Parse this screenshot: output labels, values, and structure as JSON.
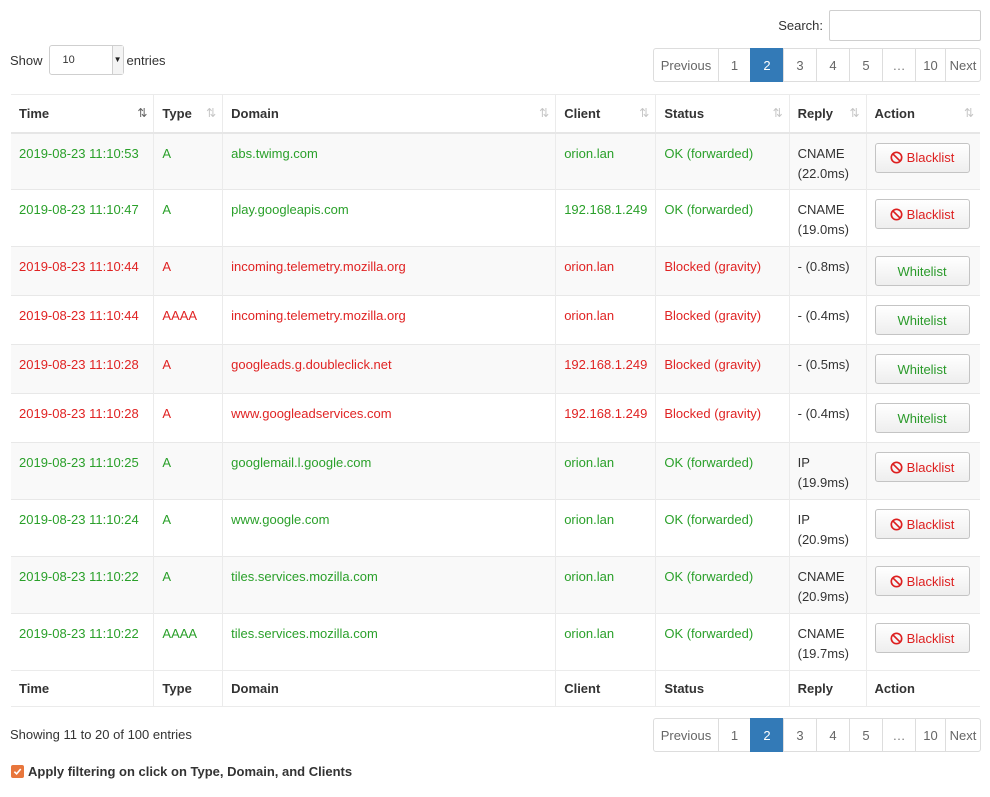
{
  "search": {
    "label": "Search:",
    "value": ""
  },
  "length": {
    "show": "Show",
    "value": "10",
    "entries": "entries"
  },
  "pagination": {
    "pages": [
      {
        "label": "Previous",
        "state": "normal",
        "w": 66
      },
      {
        "label": "1",
        "state": "normal",
        "w": 33
      },
      {
        "label": "2",
        "state": "active",
        "w": 34
      },
      {
        "label": "3",
        "state": "normal",
        "w": 34
      },
      {
        "label": "4",
        "state": "normal",
        "w": 34
      },
      {
        "label": "5",
        "state": "normal",
        "w": 34
      },
      {
        "label": "…",
        "state": "disabled",
        "w": 34
      },
      {
        "label": "10",
        "state": "normal",
        "w": 31
      },
      {
        "label": "Next",
        "state": "normal",
        "w": 36
      }
    ]
  },
  "table": {
    "headers": [
      "Time",
      "Type",
      "Domain",
      "Client",
      "Status",
      "Reply",
      "Action"
    ],
    "rows": [
      {
        "time": "2019-08-23 11:10:53",
        "type": "A",
        "domain": "abs.twimg.com",
        "client": "orion.lan",
        "status": "OK (forwarded)",
        "reply_type": "CNAME",
        "reply_time": "(22.0ms)",
        "action": "Blacklist",
        "blocked": false
      },
      {
        "time": "2019-08-23 11:10:47",
        "type": "A",
        "domain": "play.googleapis.com",
        "client": "192.168.1.249",
        "status": "OK (forwarded)",
        "reply_type": "CNAME",
        "reply_time": "(19.0ms)",
        "action": "Blacklist",
        "blocked": false
      },
      {
        "time": "2019-08-23 11:10:44",
        "type": "A",
        "domain": "incoming.telemetry.mozilla.org",
        "client": "orion.lan",
        "status": "Blocked (gravity)",
        "reply_type": "- (0.8ms)",
        "reply_time": "",
        "action": "Whitelist",
        "blocked": true
      },
      {
        "time": "2019-08-23 11:10:44",
        "type": "AAAA",
        "domain": "incoming.telemetry.mozilla.org",
        "client": "orion.lan",
        "status": "Blocked (gravity)",
        "reply_type": "- (0.4ms)",
        "reply_time": "",
        "action": "Whitelist",
        "blocked": true
      },
      {
        "time": "2019-08-23 11:10:28",
        "type": "A",
        "domain": "googleads.g.doubleclick.net",
        "client": "192.168.1.249",
        "status": "Blocked (gravity)",
        "reply_type": "- (0.5ms)",
        "reply_time": "",
        "action": "Whitelist",
        "blocked": true
      },
      {
        "time": "2019-08-23 11:10:28",
        "type": "A",
        "domain": "www.googleadservices.com",
        "client": "192.168.1.249",
        "status": "Blocked (gravity)",
        "reply_type": "- (0.4ms)",
        "reply_time": "",
        "action": "Whitelist",
        "blocked": true
      },
      {
        "time": "2019-08-23 11:10:25",
        "type": "A",
        "domain": "googlemail.l.google.com",
        "client": "orion.lan",
        "status": "OK (forwarded)",
        "reply_type": "IP",
        "reply_time": "(19.9ms)",
        "action": "Blacklist",
        "blocked": false
      },
      {
        "time": "2019-08-23 11:10:24",
        "type": "A",
        "domain": "www.google.com",
        "client": "orion.lan",
        "status": "OK (forwarded)",
        "reply_type": "IP",
        "reply_time": "(20.9ms)",
        "action": "Blacklist",
        "blocked": false
      },
      {
        "time": "2019-08-23 11:10:22",
        "type": "A",
        "domain": "tiles.services.mozilla.com",
        "client": "orion.lan",
        "status": "OK (forwarded)",
        "reply_type": "CNAME",
        "reply_time": "(20.9ms)",
        "action": "Blacklist",
        "blocked": false
      },
      {
        "time": "2019-08-23 11:10:22",
        "type": "AAAA",
        "domain": "tiles.services.mozilla.com",
        "client": "orion.lan",
        "status": "OK (forwarded)",
        "reply_type": "CNAME",
        "reply_time": "(19.7ms)",
        "action": "Blacklist",
        "blocked": false
      }
    ]
  },
  "info": "Showing 11 to 20 of 100 entries",
  "filter_option": {
    "label": "Apply filtering on click on Type, Domain, and Clients",
    "checked": true
  },
  "colors": {
    "ok": "#2aa02a",
    "blocked": "#e02323",
    "accent": "#337ab7",
    "checkbox": "#e8763c"
  }
}
